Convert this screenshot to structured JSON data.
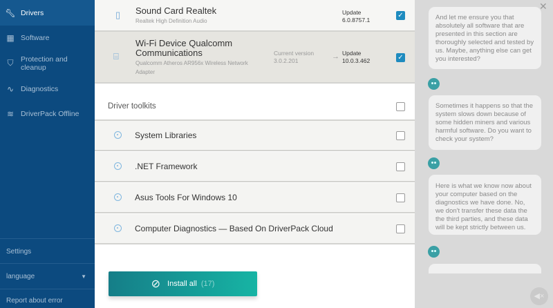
{
  "sidebar": {
    "items": [
      {
        "label": "Drivers",
        "icon": "wrench-icon",
        "active": true
      },
      {
        "label": "Software",
        "icon": "grid-icon"
      },
      {
        "label": "Protection and cleanup",
        "icon": "shield-icon"
      },
      {
        "label": "Diagnostics",
        "icon": "pulse-icon"
      },
      {
        "label": "DriverPack Offline",
        "icon": "layers-icon"
      }
    ],
    "settings": "Settings",
    "language": "language",
    "report": "Report about error"
  },
  "drivers": [
    {
      "name": "Sound Card Realtek",
      "subtitle": "Realtek High Definition Audio",
      "update_label": "Update",
      "update_version": "6.0.8757.1",
      "checked": true,
      "icon": "speaker-icon"
    },
    {
      "name": "Wi-Fi Device Qualcomm Communications",
      "subtitle": "Qualcomm Atheros AR956x Wireless Network Adapter",
      "current_label": "Current version",
      "current_version": "3.0.2.201",
      "update_label": "Update",
      "update_version": "10.0.3.462",
      "checked": true,
      "icon": "router-icon"
    }
  ],
  "toolkits": {
    "title": "Driver toolkits",
    "checked": false,
    "items": [
      {
        "label": "System Libraries",
        "checked": false
      },
      {
        "label": ".NET Framework",
        "checked": false
      },
      {
        "label": "Asus Tools For Windows 10",
        "checked": false
      },
      {
        "label": "Computer Diagnostics — Based On DriverPack Cloud",
        "checked": false
      }
    ]
  },
  "install": {
    "label": "Install all",
    "count": "(17)"
  },
  "chat": {
    "messages": [
      "And let me ensure you that absolutely all software that are presented in this section are thoroughly selected and tested by us. Maybe, anything else can get you interested?",
      "Sometimes it happens so that the system slows down because of some hidden miners and various harmful software. Do you want to check your system?",
      "Here is what we know now about your computer based on the diagnostics we have done. No, we don't transfer these data the the third parties, and these data will be kept strictly between us."
    ]
  },
  "colors": {
    "sidebar": "#0c4a7f",
    "accent": "#1e8bbf",
    "install_start": "#157e88",
    "install_end": "#17b4a4"
  }
}
